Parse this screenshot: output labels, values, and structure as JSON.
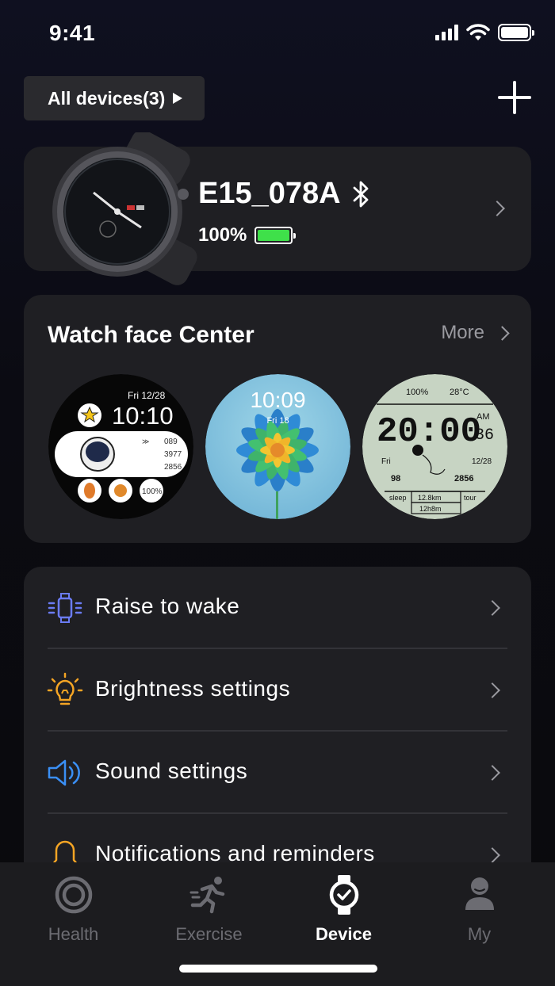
{
  "status": {
    "time": "9:41"
  },
  "header": {
    "devices_label": "All devices(3)"
  },
  "device": {
    "name": "E15_078A",
    "battery": "100%",
    "battery_color": "#3fe04a"
  },
  "watch_faces": {
    "title": "Watch face Center",
    "more": "More",
    "faces": [
      {
        "date": "Fri  12/28",
        "time": "10:10",
        "stats": [
          "089",
          "3977",
          "2856"
        ],
        "badge": "100%"
      },
      {
        "time": "10:09",
        "date": "Fri  18"
      },
      {
        "battery": "100%",
        "temp": "28°C",
        "time": "20:00",
        "ampm": "AM",
        "seconds": "36",
        "day": "Fri",
        "date": "12/28",
        "heart": "98",
        "steps": "2856",
        "sleep": "sleep",
        "distance": "12.8km",
        "tour": "tour",
        "duration": "12h8m"
      }
    ]
  },
  "settings": {
    "items": [
      {
        "label": "Raise to wake",
        "icon": "raise-to-wake-icon",
        "color": "#6b7cf5"
      },
      {
        "label": "Brightness settings",
        "icon": "lightbulb-icon",
        "color": "#f5a524"
      },
      {
        "label": "Sound settings",
        "icon": "speaker-icon",
        "color": "#3a8ff5"
      },
      {
        "label": "Notifications and reminders",
        "icon": "bell-icon",
        "color": "#f5a524"
      }
    ]
  },
  "tabs": [
    {
      "label": "Health",
      "icon": "health-ring-icon",
      "active": false
    },
    {
      "label": "Exercise",
      "icon": "running-icon",
      "active": false
    },
    {
      "label": "Device",
      "icon": "watch-icon",
      "active": true
    },
    {
      "label": "My",
      "icon": "person-icon",
      "active": false
    }
  ]
}
